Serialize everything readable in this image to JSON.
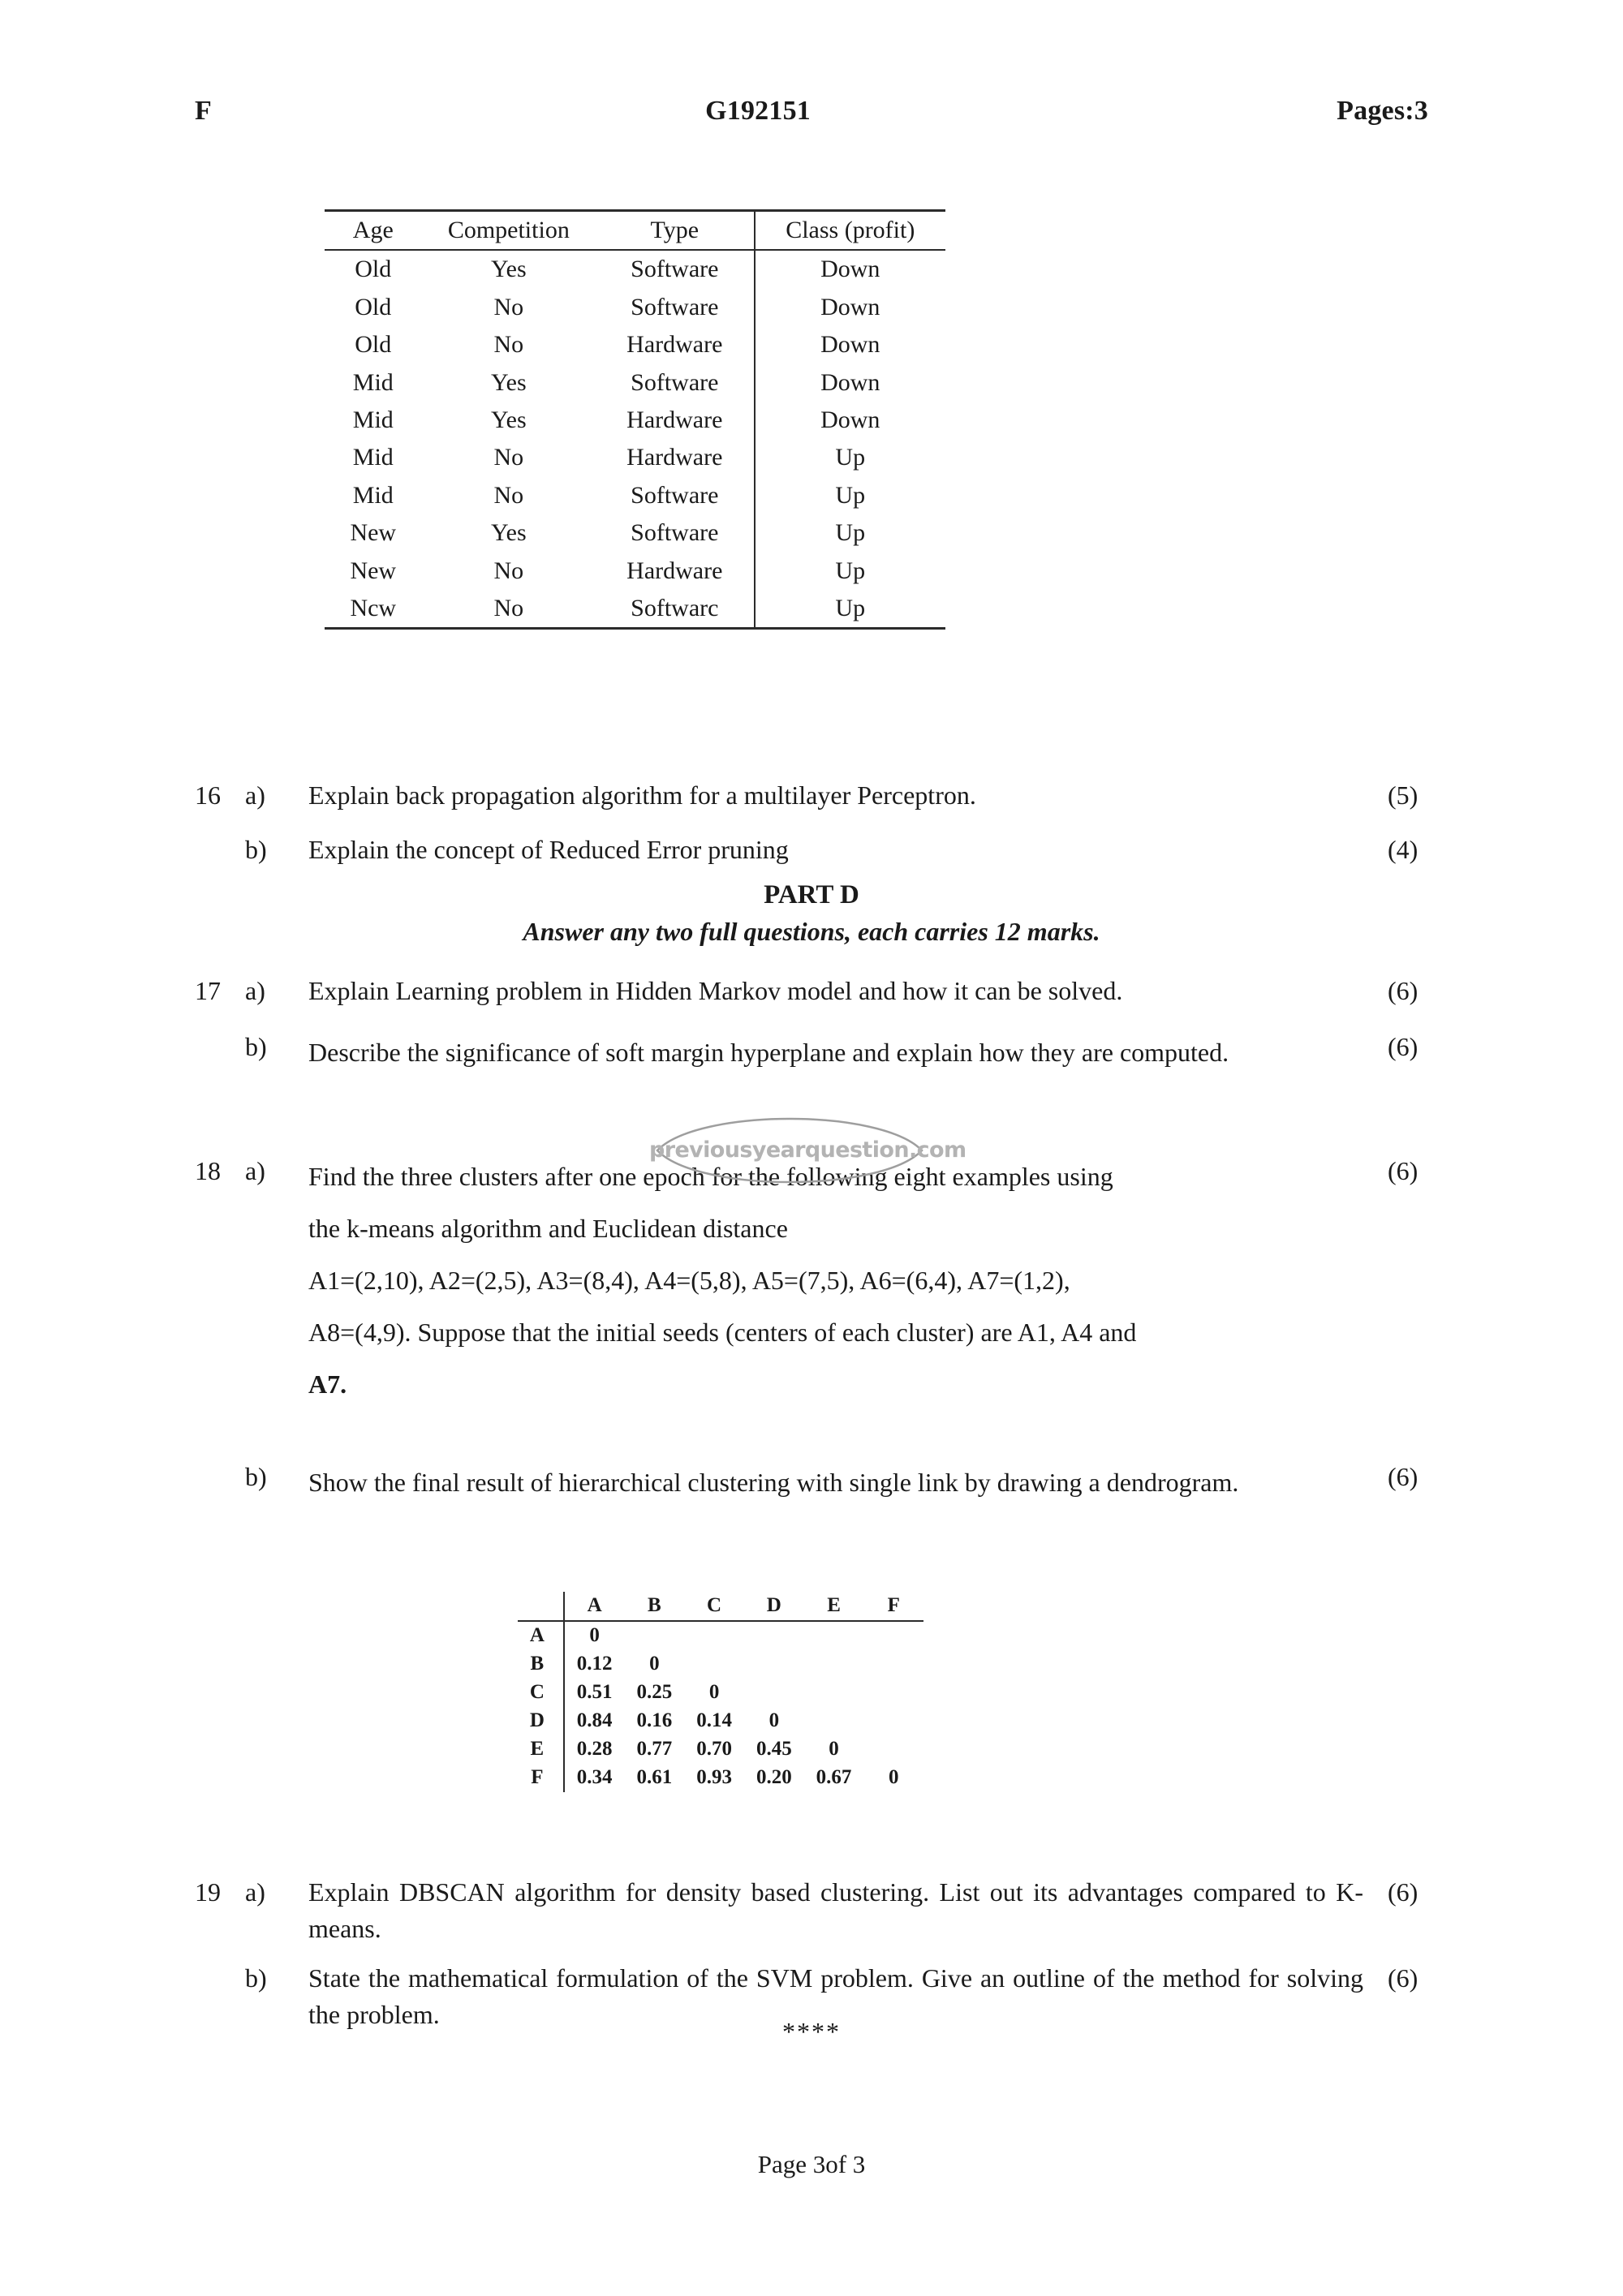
{
  "header": {
    "left_code": "F",
    "paper_code": "G192151",
    "pages_label": "Pages:3"
  },
  "dataset_table": {
    "columns": [
      "Age",
      "Competition",
      "Type",
      "Class (profit)"
    ],
    "rows": [
      [
        "Old",
        "Yes",
        "Software",
        "Down"
      ],
      [
        "Old",
        "No",
        "Software",
        "Down"
      ],
      [
        "Old",
        "No",
        "Hardware",
        "Down"
      ],
      [
        "Mid",
        "Yes",
        "Software",
        "Down"
      ],
      [
        "Mid",
        "Yes",
        "Hardware",
        "Down"
      ],
      [
        "Mid",
        "No",
        "Hardware",
        "Up"
      ],
      [
        "Mid",
        "No",
        "Software",
        "Up"
      ],
      [
        "New",
        "Yes",
        "Software",
        "Up"
      ],
      [
        "New",
        "No",
        "Hardware",
        "Up"
      ],
      [
        "Ncw",
        "No",
        "Softwarc",
        "Up"
      ]
    ]
  },
  "questions": {
    "q16": {
      "number": "16",
      "a": {
        "letter": "a)",
        "text": "Explain back propagation algorithm for a multilayer Perceptron.",
        "marks": "(5)"
      },
      "b": {
        "letter": "b)",
        "text": "Explain the concept of Reduced Error pruning",
        "marks": "(4)"
      }
    },
    "q17": {
      "number": "17",
      "a": {
        "letter": "a)",
        "text": "Explain Learning problem in Hidden Markov model and how it can be solved.",
        "marks": "(6)"
      },
      "b": {
        "letter": "b)",
        "text": "Describe the significance of soft margin hyperplane  and explain how they are computed.",
        "marks": "(6)"
      }
    },
    "q18": {
      "number": "18",
      "a": {
        "letter": "a)",
        "line1": "Find the three clusters after one epoch for the following eight examples using",
        "line2": "the k-means algorithm and Euclidean distance",
        "line3": "A1=(2,10),  A2=(2,5),  A3=(8,4),  A4=(5,8),  A5=(7,5),  A6=(6,4),  A7=(1,2),",
        "line4": "A8=(4,9). Suppose that the initial seeds (centers of each cluster) are A1, A4 and",
        "line5": "A7.",
        "marks": "(6)"
      },
      "b": {
        "letter": "b)",
        "text": "Show the final result of hierarchical clustering with single link by drawing a dendrogram.",
        "marks": "(6)"
      }
    },
    "q19": {
      "number": "19",
      "a": {
        "letter": "a)",
        "text": "Explain DBSCAN algorithm for density based clustering. List out its advantages compared to K-means.",
        "marks": "(6)"
      },
      "b": {
        "letter": "b)",
        "text": "State the mathematical formulation of the SVM problem. Give an outline of the method for solving the problem.",
        "marks": "(6)"
      }
    }
  },
  "part_d": {
    "heading": "PART D",
    "subheading": "Answer any two full questions, each carries 12 marks."
  },
  "distance_matrix": {
    "col_headers": [
      "A",
      "B",
      "C",
      "D",
      "E",
      "F"
    ],
    "row_labels": [
      "A",
      "B",
      "C",
      "D",
      "E",
      "F"
    ],
    "rows": [
      [
        "0"
      ],
      [
        "0.12",
        "0"
      ],
      [
        "0.51",
        "0.25",
        "0"
      ],
      [
        "0.84",
        "0.16",
        "0.14",
        "0"
      ],
      [
        "0.28",
        "0.77",
        "0.70",
        "0.45",
        "0"
      ],
      [
        "0.34",
        "0.61",
        "0.93",
        "0.20",
        "0.67",
        "0"
      ]
    ]
  },
  "watermark": {
    "text": "previousyearquestion.com",
    "color": "#b3b3b3"
  },
  "footer": {
    "stars": "****",
    "page_label": "Page 3of 3"
  }
}
